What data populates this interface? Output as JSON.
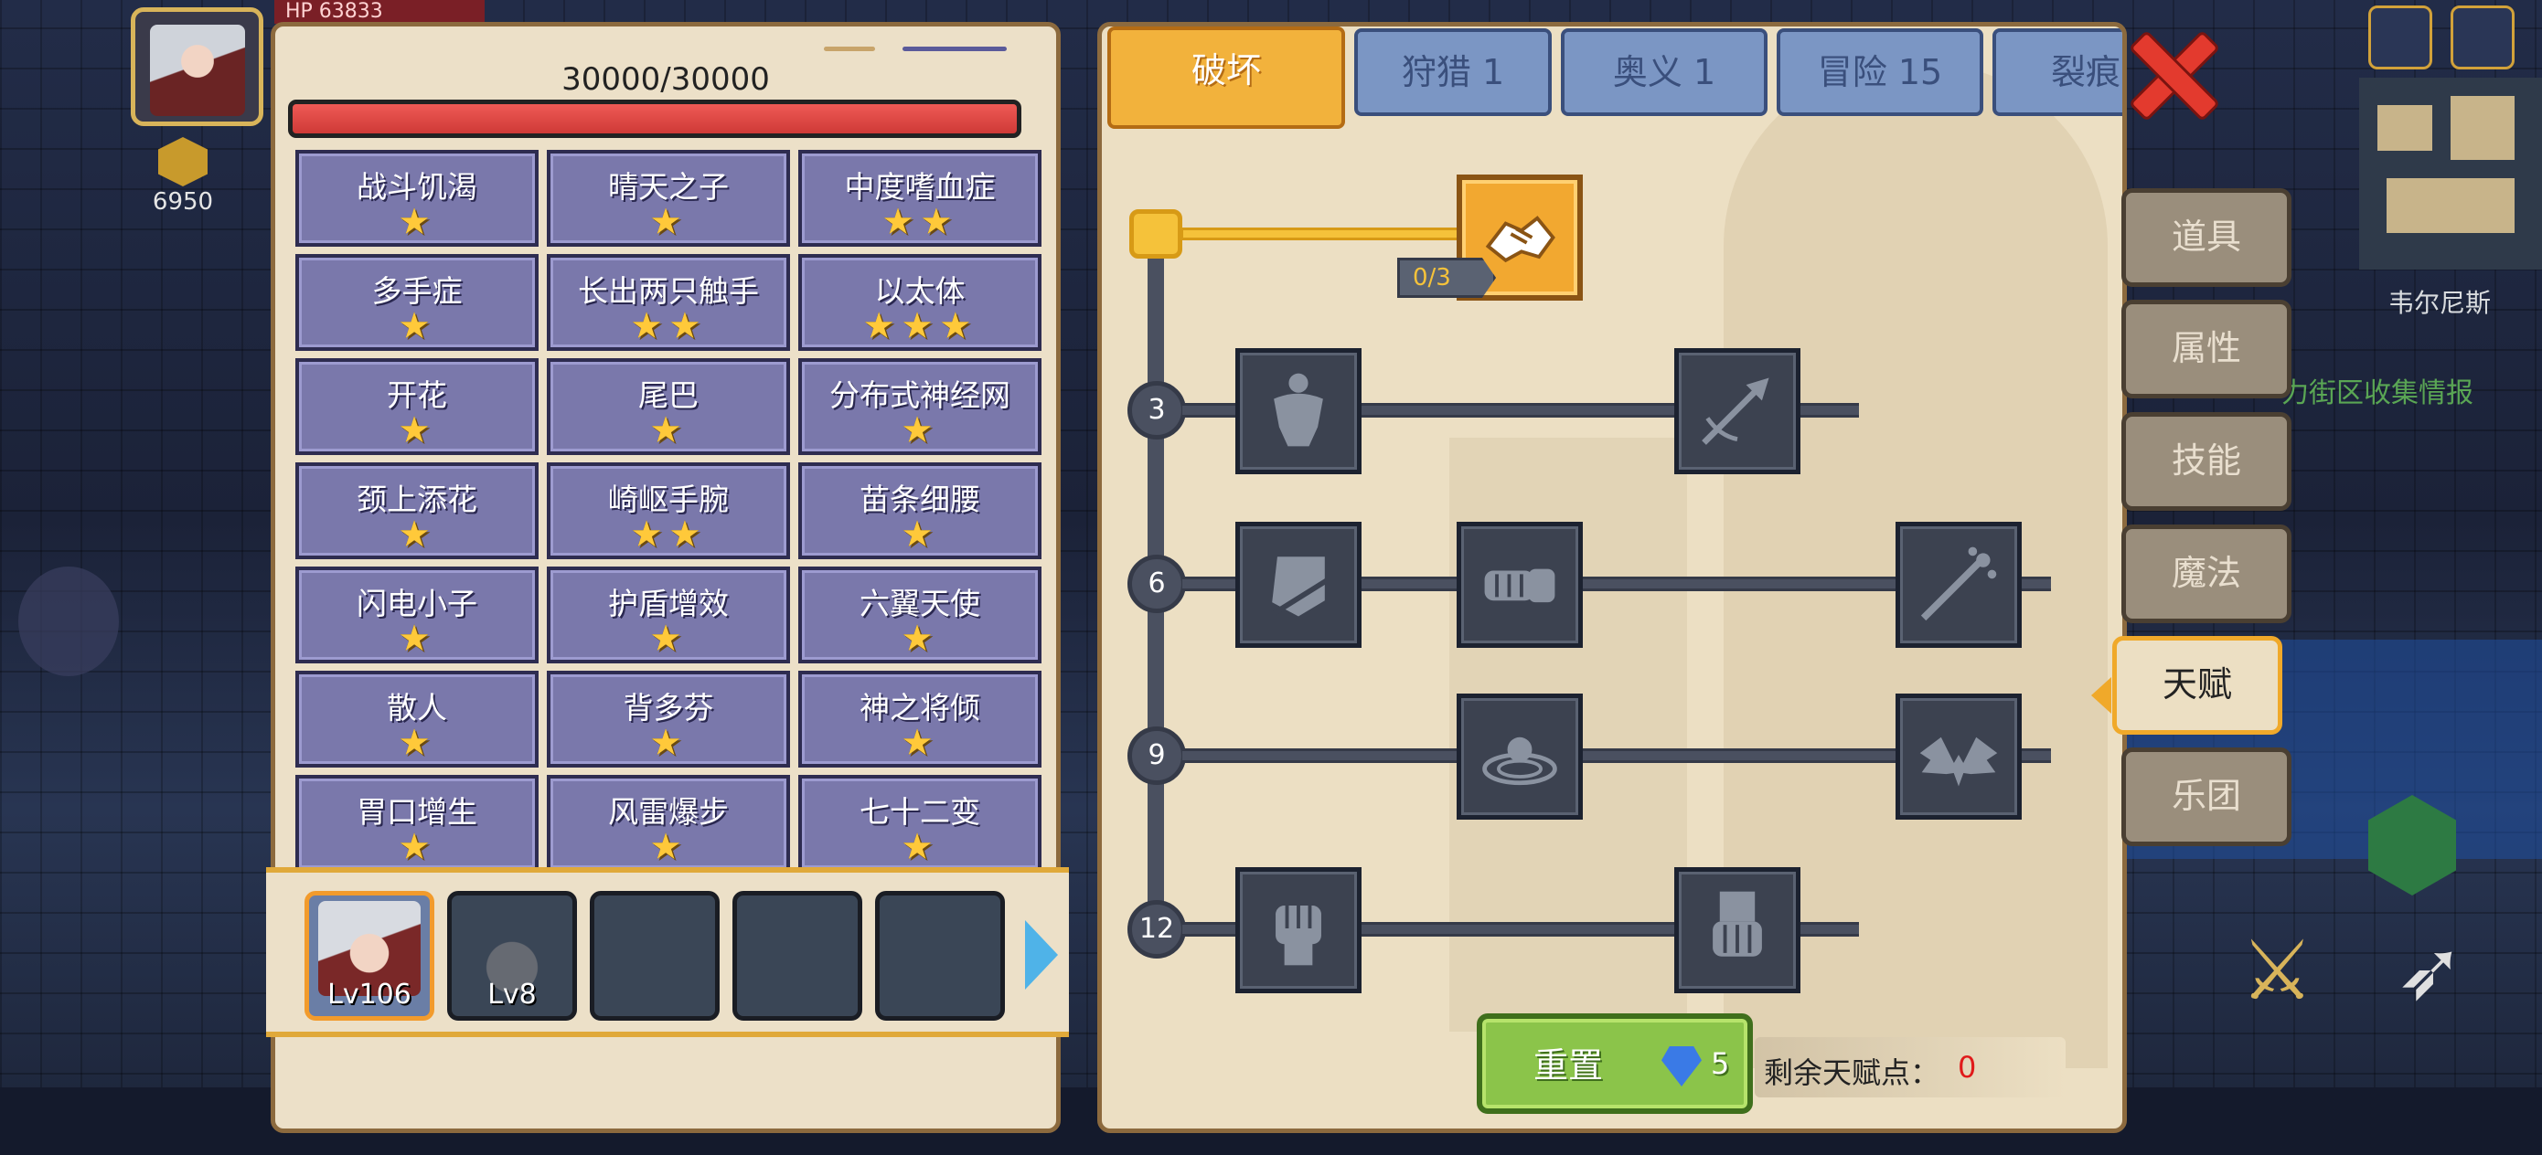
{
  "hud": {
    "hp_readout": "HP 63833",
    "energy": "6950"
  },
  "background": {
    "map_location": "韦尔尼斯",
    "quest_hint": "力街区收集情报"
  },
  "character_panel": {
    "hp_text": "30000/30000",
    "hp_fraction": 1.0,
    "traits": [
      {
        "name": "战斗饥渴",
        "stars": "★"
      },
      {
        "name": "晴天之子",
        "stars": "★"
      },
      {
        "name": "中度嗜血症",
        "stars": "★★"
      },
      {
        "name": "多手症",
        "stars": "★"
      },
      {
        "name": "长出两只触手",
        "stars": "★★"
      },
      {
        "name": "以太体",
        "stars": "★★★"
      },
      {
        "name": "开花",
        "stars": "★"
      },
      {
        "name": "尾巴",
        "stars": "★"
      },
      {
        "name": "分布式神经网",
        "stars": "★"
      },
      {
        "name": "颈上添花",
        "stars": "★"
      },
      {
        "name": "崎岖手腕",
        "stars": "★★"
      },
      {
        "name": "苗条细腰",
        "stars": "★"
      },
      {
        "name": "闪电小子",
        "stars": "★"
      },
      {
        "name": "护盾增效",
        "stars": "★"
      },
      {
        "name": "六翼天使",
        "stars": "★"
      },
      {
        "name": "散人",
        "stars": "★"
      },
      {
        "name": "背多芬",
        "stars": "★"
      },
      {
        "name": "神之将倾",
        "stars": "★"
      },
      {
        "name": "胃口增生",
        "stars": "★"
      },
      {
        "name": "风雷爆步",
        "stars": "★"
      },
      {
        "name": "七十二变",
        "stars": "★"
      }
    ],
    "roster": [
      {
        "level": "Lv106",
        "selected": true
      },
      {
        "level": "Lv8",
        "selected": false
      },
      {
        "level": "",
        "selected": false
      },
      {
        "level": "",
        "selected": false
      },
      {
        "level": "",
        "selected": false
      }
    ]
  },
  "talent_panel": {
    "tabs": [
      "破坏",
      "狩猎 1",
      "奥义 1",
      "冒险 15",
      "裂痕"
    ],
    "active_tab": 0,
    "tier_levels": [
      "3",
      "6",
      "9",
      "12"
    ],
    "root_talent": {
      "icon": "handshake-icon",
      "progress": "0/3"
    },
    "tier_talents": [
      {
        "tier": "3",
        "icons": [
          "muscle-body-icon",
          "arrow-strike-icon"
        ]
      },
      {
        "tier": "6",
        "icons": [
          "shield-slash-icon",
          "punch-icon",
          "splash-strike-icon"
        ]
      },
      {
        "tier": "9",
        "icons": [
          "orb-ripple-icon",
          "demon-wings-icon"
        ]
      },
      {
        "tier": "12",
        "icons": [
          "fist-icon",
          "gauntlet-icon"
        ]
      }
    ],
    "reset": {
      "label": "重置",
      "cost": "5"
    },
    "remaining_points_label": "剩余天赋点：",
    "remaining_points": "0"
  },
  "side_menu": {
    "items": [
      "道具",
      "属性",
      "技能",
      "魔法",
      "天赋",
      "乐团"
    ],
    "active": 4
  },
  "colors": {
    "accent_orange": "#f2b23c",
    "tab_blue": "#7b96c4",
    "reset_green": "#8bc44a",
    "hp_red": "#ef5a55",
    "points_red": "#e01a1a"
  }
}
